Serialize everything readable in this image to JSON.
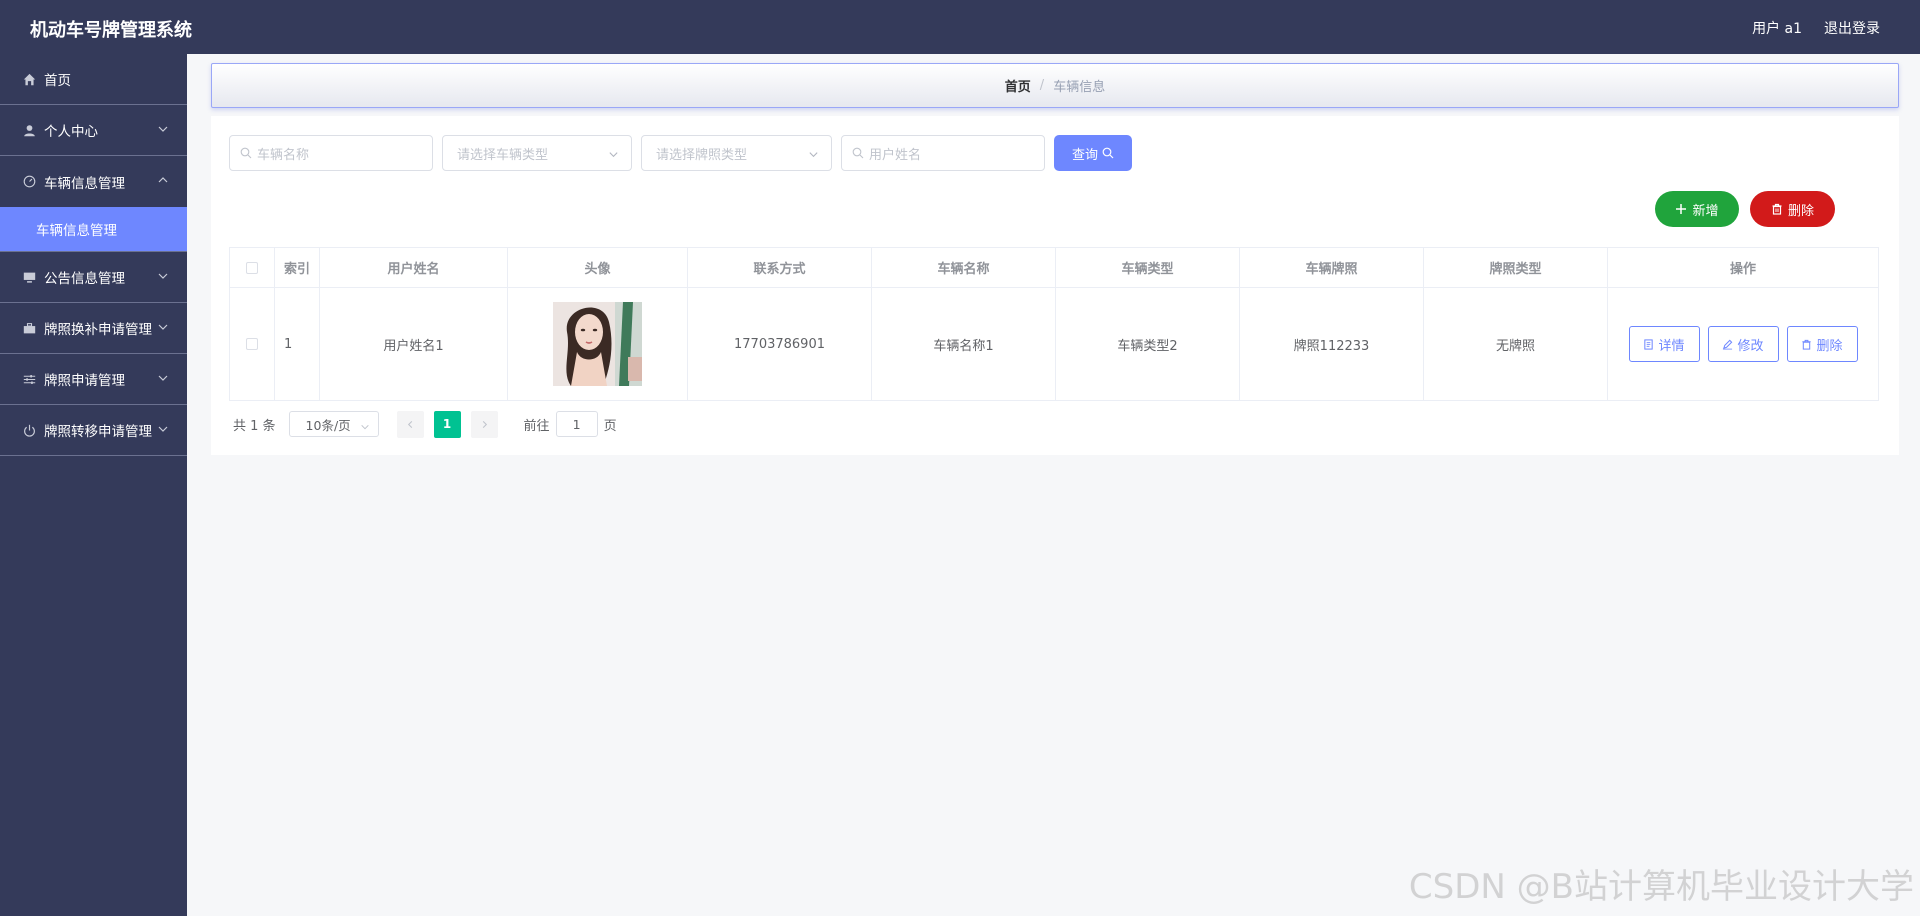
{
  "header": {
    "title": "机动车号牌管理系统",
    "user_label": "用户 a1",
    "logout_label": "退出登录"
  },
  "sidebar": {
    "items": [
      {
        "label": "首页"
      },
      {
        "label": "个人中心"
      },
      {
        "label": "车辆信息管理"
      },
      {
        "label": "车辆信息管理"
      },
      {
        "label": "公告信息管理"
      },
      {
        "label": "牌照换补申请管理"
      },
      {
        "label": "牌照申请管理"
      },
      {
        "label": "牌照转移申请管理"
      }
    ]
  },
  "breadcrumb": {
    "home": "首页",
    "separator": "/",
    "current": "车辆信息"
  },
  "search": {
    "vehicle_name_placeholder": "车辆名称",
    "vehicle_type_placeholder": "请选择车辆类型",
    "plate_type_placeholder": "请选择牌照类型",
    "user_name_placeholder": "用户姓名",
    "query_label": "查询"
  },
  "actions": {
    "add_label": "新增",
    "delete_label": "删除"
  },
  "table": {
    "columns": [
      "索引",
      "用户姓名",
      "头像",
      "联系方式",
      "车辆名称",
      "车辆类型",
      "车辆牌照",
      "牌照类型",
      "操作"
    ],
    "rows": [
      {
        "index": "1",
        "user_name": "用户姓名1",
        "phone": "17703786901",
        "vehicle_name": "车辆名称1",
        "vehicle_type": "车辆类型2",
        "plate": "牌照112233",
        "plate_type": "无牌照"
      }
    ],
    "row_actions": {
      "detail": "详情",
      "edit": "修改",
      "delete": "删除"
    }
  },
  "pagination": {
    "total_text": "共 1 条",
    "page_size": "10条/页",
    "current_page": "1",
    "goto_label": "前往",
    "goto_value": "1",
    "page_suffix": "页"
  },
  "watermark": "CSDN @B站计算机毕业设计大学",
  "colors": {
    "sidebar_bg": "#343a5a",
    "accent": "#6e87ff",
    "add_button": "#20a43c",
    "delete_button": "#d21a1a",
    "page_active": "#00c292"
  }
}
